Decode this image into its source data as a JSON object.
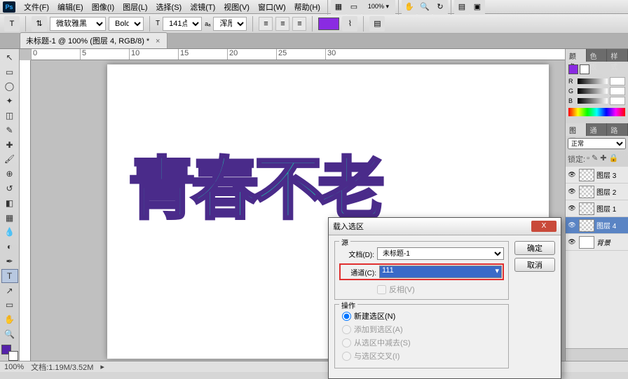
{
  "menubar": {
    "items": [
      "文件(F)",
      "编辑(E)",
      "图像(I)",
      "图层(L)",
      "选择(S)",
      "滤镜(T)",
      "视图(V)",
      "窗口(W)",
      "帮助(H)"
    ]
  },
  "optbar": {
    "font_family": "微软雅黑",
    "font_weight": "Bold",
    "font_size": "141点",
    "aa": "浑厚"
  },
  "doc_tab": {
    "label": "未标题-1 @ 100% (图层 4, RGB/8) *"
  },
  "artwork_text": "青春不老",
  "statusbar": {
    "zoom": "100%",
    "info": "文档:1.19M/3.52M"
  },
  "color_panel": {
    "tabs": [
      "颜色",
      "色板",
      "样式"
    ],
    "r": "",
    "g": "",
    "b": ""
  },
  "layers_panel": {
    "tabs": [
      "图层",
      "通道",
      "路径"
    ],
    "blend_mode": "正常",
    "lock_label": "锁定:",
    "layers": [
      {
        "name": "图层 3",
        "visible": true
      },
      {
        "name": "图层 2",
        "visible": true
      },
      {
        "name": "图层 1",
        "visible": true
      },
      {
        "name": "图层 4",
        "visible": true,
        "active": true
      },
      {
        "name": "背景",
        "visible": true,
        "bg": true
      }
    ]
  },
  "dialog": {
    "title": "载入选区",
    "ok": "确定",
    "cancel": "取消",
    "src_legend": "源",
    "doc_label": "文档(D):",
    "doc_value": "未标题-1",
    "chan_label": "通道(C):",
    "chan_value": "111",
    "invert_label": "反相(V)",
    "op_legend": "操作",
    "ops": [
      {
        "label": "新建选区(N)",
        "checked": true
      },
      {
        "label": "添加到选区(A)"
      },
      {
        "label": "从选区中减去(S)"
      },
      {
        "label": "与选区交叉(I)"
      }
    ]
  },
  "ruler_marks": [
    "0",
    "5",
    "10",
    "15",
    "20",
    "25",
    "30"
  ]
}
